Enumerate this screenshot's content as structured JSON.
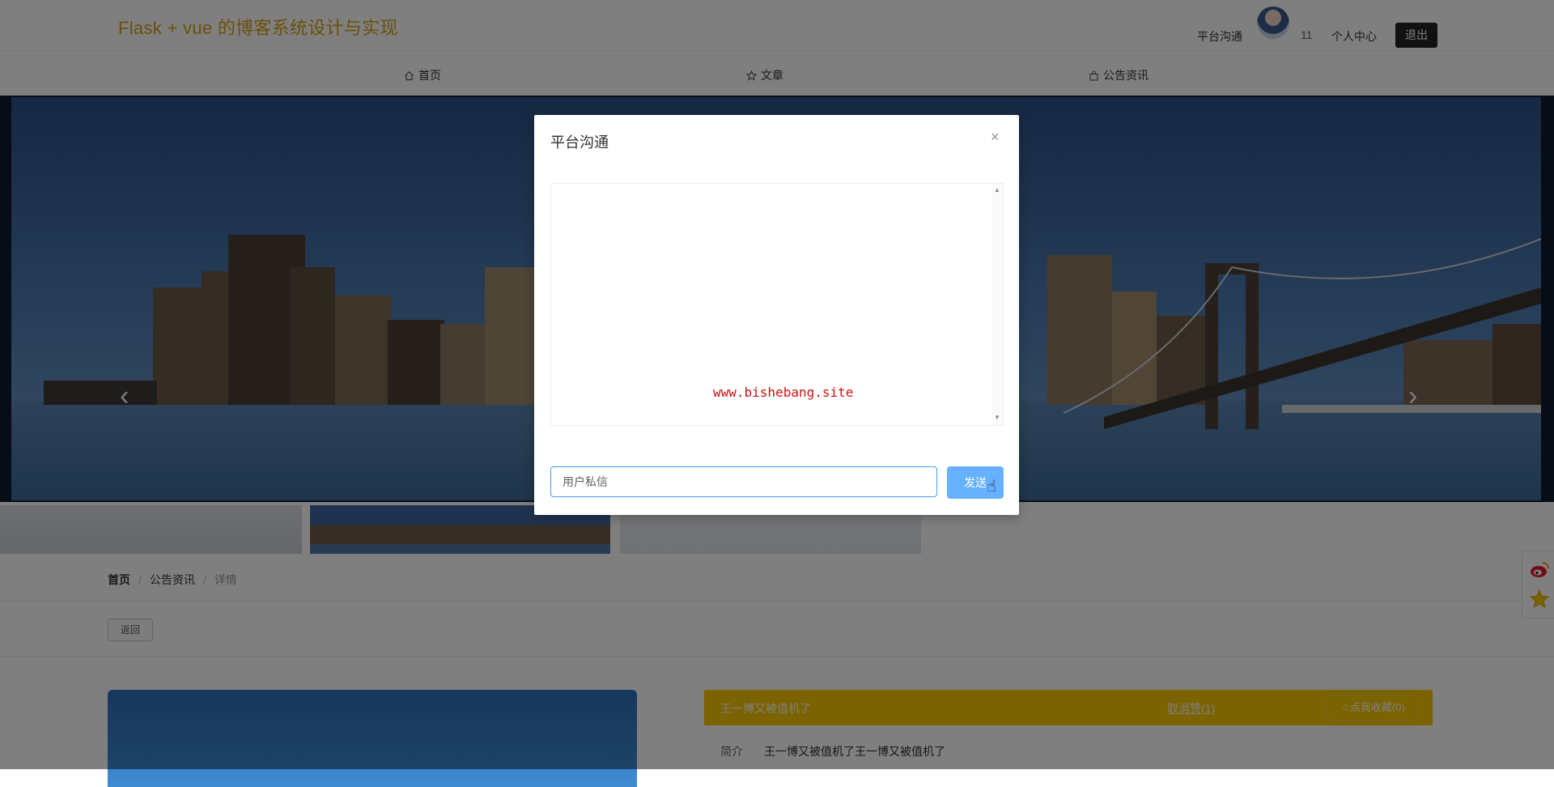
{
  "app": {
    "title": "Flask + vue 的博客系统设计与实现"
  },
  "header": {
    "chat_label": "平台沟通",
    "username": "11",
    "profile_label": "个人中心",
    "logout_label": "退出"
  },
  "nav": {
    "items": [
      {
        "label": "首页",
        "icon": "home-icon"
      },
      {
        "label": "文章",
        "icon": "star-icon"
      },
      {
        "label": "公告资讯",
        "icon": "bag-icon"
      }
    ]
  },
  "carousel": {
    "prev_arrow": "‹",
    "next_arrow": "›"
  },
  "breadcrumb": {
    "items": [
      "首页",
      "公告资讯",
      "详情"
    ],
    "separator": "/"
  },
  "detail": {
    "back_label": "返回",
    "title": "王一博又被值机了",
    "like_label": "取消赞(1)",
    "favorite_label": "☆点我收藏(0)",
    "intro_key": "简介",
    "intro_value": "王一博又被值机了王一博又被值机了"
  },
  "modal": {
    "title": "平台沟通",
    "close": "×",
    "watermark": "www.bishebang.site",
    "input_placeholder": "用户私信",
    "send_label": "发送"
  },
  "colors": {
    "brand_title": "#d4a017",
    "article_bar": "#f7c600",
    "send_button": "#66b1ff",
    "input_border": "#409eff",
    "watermark": "#cc1111"
  }
}
